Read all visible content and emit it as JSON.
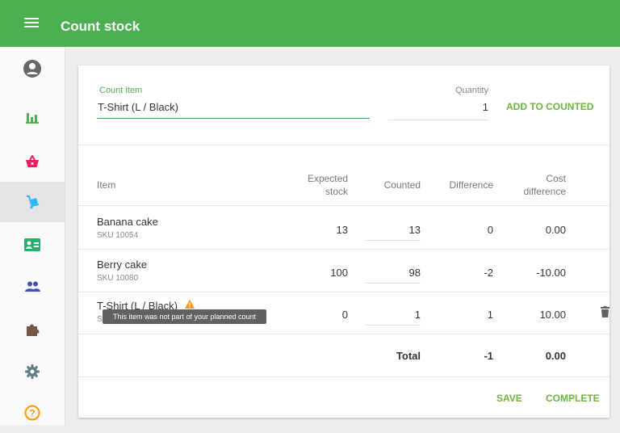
{
  "header": {
    "title": "Count stock"
  },
  "sidebar": {
    "items": [
      {
        "name": "account",
        "icon": "account-icon",
        "color": "#666666"
      },
      {
        "name": "reports",
        "icon": "bar-chart-icon",
        "color": "#4caf50"
      },
      {
        "name": "sales",
        "icon": "basket-icon",
        "color": "#e91e63"
      },
      {
        "name": "inventory",
        "icon": "trolley-icon",
        "color": "#29b6f6",
        "active": true
      },
      {
        "name": "customers",
        "icon": "contact-card-icon",
        "color": "#2eaa6a"
      },
      {
        "name": "employees",
        "icon": "people-icon",
        "color": "#3f51b5"
      },
      {
        "name": "add-ons",
        "icon": "puzzle-icon",
        "color": "#795548"
      },
      {
        "name": "settings",
        "icon": "gear-icon",
        "color": "#607d8b"
      },
      {
        "name": "help",
        "icon": "help-icon",
        "color": "#ff9800"
      }
    ]
  },
  "form": {
    "count_item_label": "Count item",
    "count_item_value": "T-Shirt (L / Black)",
    "quantity_label": "Quantity",
    "quantity_value": "1",
    "add_button": "ADD TO COUNTED"
  },
  "table": {
    "headers": {
      "item": "Item",
      "expected_1": "Expected",
      "expected_2": "stock",
      "counted": "Counted",
      "difference": "Difference",
      "cost_1": "Cost",
      "cost_2": "difference"
    },
    "rows": [
      {
        "name": "Banana cake",
        "sku": "SKU 10054",
        "expected": "13",
        "counted": "13",
        "difference": "0",
        "cost_difference": "0.00"
      },
      {
        "name": "Berry cake",
        "sku": "SKU 10080",
        "expected": "100",
        "counted": "98",
        "difference": "-2",
        "cost_difference": "-10.00"
      },
      {
        "name": "T-Shirt (L / Black)",
        "sku": "S",
        "expected": "0",
        "counted": "1",
        "difference": "1",
        "cost_difference": "10.00",
        "warning": true
      }
    ],
    "tooltip": "This item was not part of your planned count",
    "total_label": "Total",
    "total_difference": "-1",
    "total_cost_difference": "0.00"
  },
  "footer": {
    "save": "SAVE",
    "complete": "COMPLETE"
  },
  "colors": {
    "primary": "#4caf50",
    "action": "#6db33f",
    "warning": "#ff9800"
  }
}
